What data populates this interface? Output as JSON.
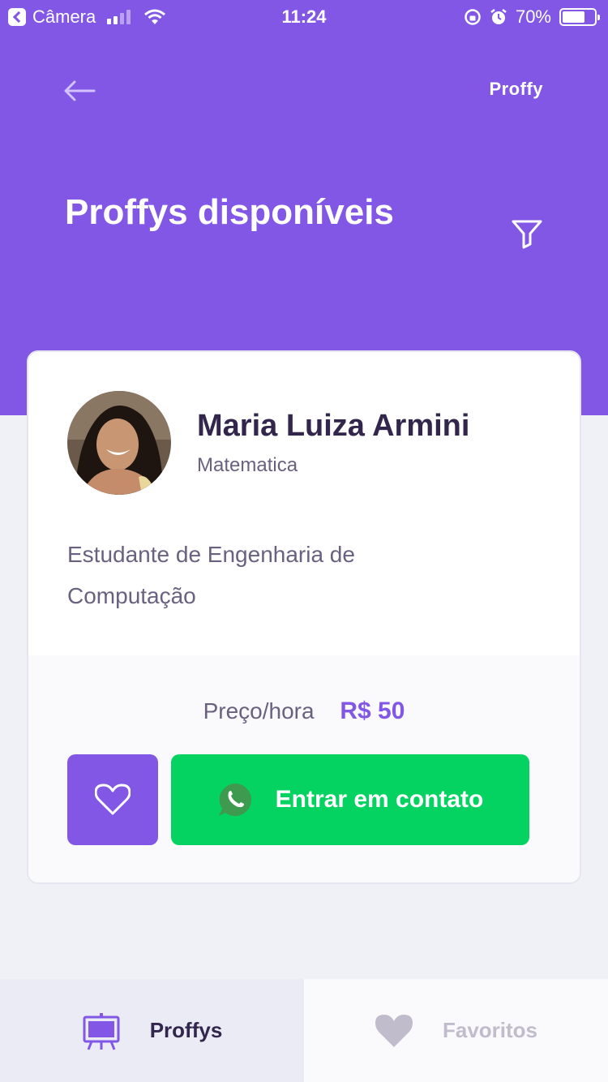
{
  "status_bar": {
    "back_app": "Câmera",
    "time": "11:24",
    "battery": "70%",
    "battery_level": 0.7
  },
  "header": {
    "brand": "Proffy",
    "title": "Proffys disponíveis"
  },
  "teacher_card": {
    "name": "Maria Luiza Armini",
    "subject": "Matematica",
    "bio": "Estudante de Engenharia de Computação",
    "price_label": "Preço/hora",
    "price_value": "R$ 50",
    "contact_label": "Entrar em contato"
  },
  "tabs": [
    {
      "label": "Proffys",
      "icon": "easel-icon",
      "active": true
    },
    {
      "label": "Favoritos",
      "icon": "heart-icon",
      "active": false
    }
  ],
  "colors": {
    "primary": "#8257E5",
    "success": "#04D361",
    "title_text": "#32264D",
    "body_text": "#6A6180",
    "muted": "#C1BCCC",
    "background": "#F0F0F7"
  }
}
